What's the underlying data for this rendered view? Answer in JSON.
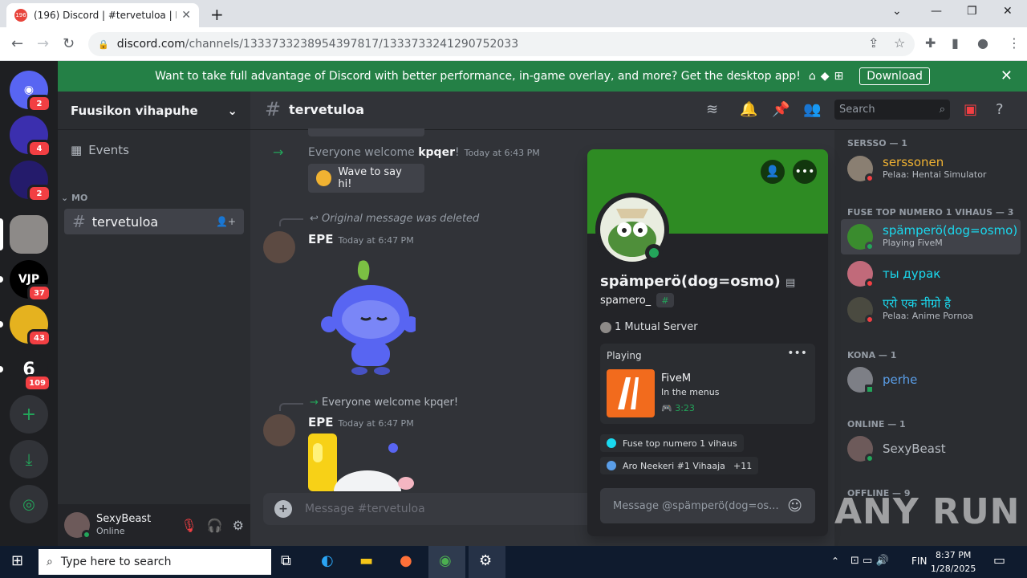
{
  "browser": {
    "tab_title": "(196) Discord | #tervetuloa | Fuu",
    "tab_badge": "196",
    "url_host": "discord.com",
    "url_path": "/channels/1333733238954397817/1333733241290752033"
  },
  "banner": {
    "text": "Want to take full advantage of Discord with better performance, in-game overlay, and more? Get the desktop app!",
    "platform_icons": " ⚙ ⊞",
    "download": "Download"
  },
  "rail": {
    "badges": [
      "2",
      "4",
      "2",
      "37",
      "43",
      "109"
    ]
  },
  "server": {
    "name": "Fuusikon vihapuhe",
    "events": "Events",
    "category": "MO",
    "channel": "tervetuloa"
  },
  "user": {
    "name": "SexyBeast",
    "status": "Online"
  },
  "chat": {
    "channel": "tervetuloa",
    "search_placeholder": "Search",
    "composer_placeholder": "Message #tervetuloa",
    "msg1_prefix": "Everyone welcome ",
    "msg1_name": "kpqer",
    "msg1_suffix": "!",
    "msg1_time": "Today at 6:43 PM",
    "wave": "Wave to say hi!",
    "reply_deleted": "Original message was deleted",
    "author1": "EPE",
    "author1_time": "Today at 6:47 PM",
    "reply2": "Everyone welcome kpqer!",
    "author2": "EPE",
    "author2_time": "Today at 6:47 PM"
  },
  "members": {
    "cat1": "SERSSO — 1",
    "m1_name": "serssonen",
    "m1_act": "Pelaa: Hentai Simulator",
    "cat2": "FUSE TOP NUMERO 1 VIHAUS — 3",
    "m2_name": "spämperö(dog=osmo)",
    "m2_act": "Playing FiveM",
    "m3_name": "ты дурак",
    "m4_name": "एरो एक नीग्रो है",
    "m4_act": "Pelaa: Anime Pornoa",
    "cat3": "KONA — 1",
    "m5_name": "perhe",
    "cat4": "ONLINE — 1",
    "m6_name": "SexyBeast",
    "cat5": "OFFLINE — 9"
  },
  "profile": {
    "display_name": "spämperö(dog=osmo)",
    "username": "spamero_",
    "tag": "#",
    "mutual": "1 Mutual Server",
    "activity_label": "Playing",
    "game": "FiveM",
    "game_state": "In the menus",
    "elapsed": "3:23",
    "role1": "Fuse top numero 1 vihaus",
    "role2": "Aro Neekeri #1 Vihaaja",
    "more_roles": "+11",
    "message_placeholder": "Message @spämperö(dog=os..."
  },
  "taskbar": {
    "search": "Type here to search",
    "lang": "FIN",
    "time": "8:37 PM",
    "date": "1/28/2025"
  },
  "watermark": "ANY RUN"
}
